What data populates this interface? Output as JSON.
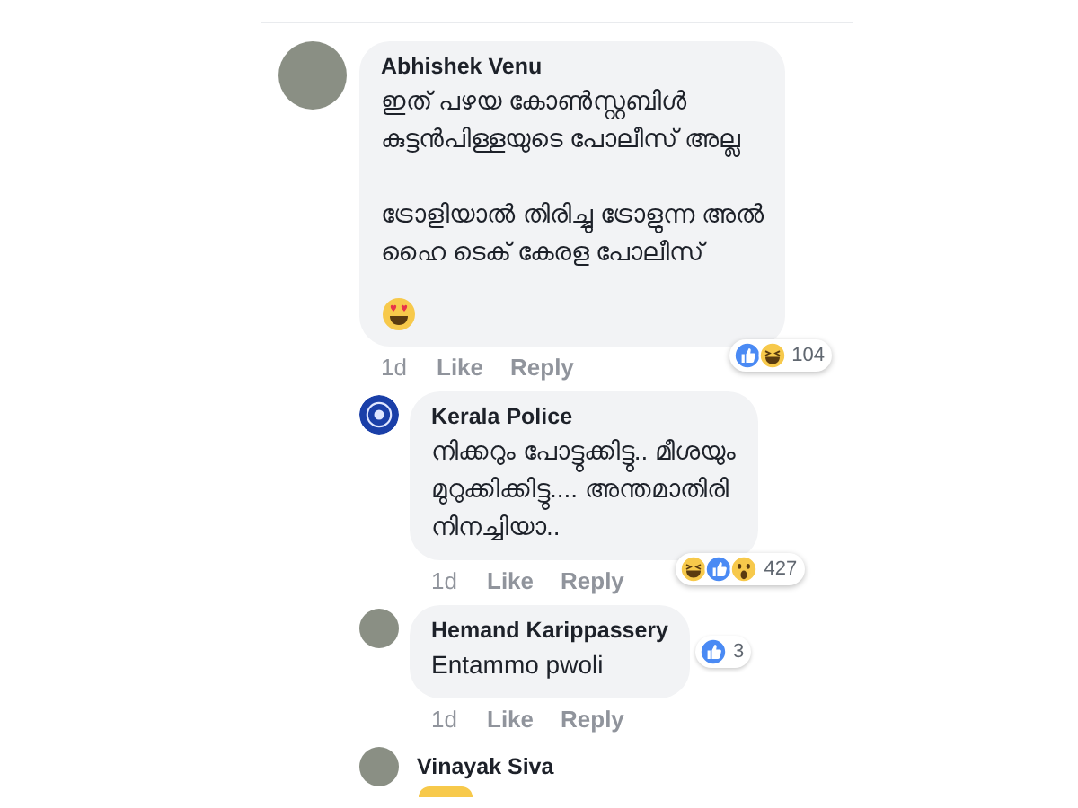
{
  "comments": [
    {
      "author": "Abhishek Venu",
      "photo_avatar": true,
      "paragraphs": [
        [
          "ഇത് പഴയ കോൺസ്റ്റബിൾ",
          "കുട്ടൻപിള്ളയുടെ പോലീസ് അല്ല"
        ],
        [
          "ട്രോളിയാൽ തിരിച്ചു ട്രോളുന്ന അൽ",
          "ഹൈ ടെക് കേരള പോലീസ്"
        ]
      ],
      "emoji": true,
      "time": "1d",
      "like": "Like",
      "reply": "Reply",
      "reactions": [
        {
          "kind": "like"
        },
        {
          "kind": "haha"
        }
      ],
      "reaction_count": "104",
      "children": [
        {
          "author": "Kerala Police",
          "photo_avatar": false,
          "paragraphs": [
            [
              "നിക്കറും പോട്ടുക്കിട്ടു.. മീശയും",
              "മുറുക്കിക്കിട്ടു.... അന്തമാതിരി",
              "നിനച്ചിയാ.."
            ]
          ],
          "emoji": false,
          "time": "1d",
          "like": "Like",
          "reply": "Reply",
          "reactions": [
            {
              "kind": "haha"
            },
            {
              "kind": "like"
            },
            {
              "kind": "wow"
            }
          ],
          "reaction_count": "427"
        },
        {
          "author": "Hemand Karippassery",
          "photo_avatar": true,
          "paragraphs": [
            [
              "Entammo pwoli"
            ]
          ],
          "emoji": false,
          "time": "1d",
          "like": "Like",
          "reply": "Reply",
          "reactions": [
            {
              "kind": "like"
            }
          ],
          "reaction_count": "3"
        },
        {
          "author": "Vinayak Siva",
          "photo_avatar": true,
          "sticker": true
        }
      ]
    }
  ]
}
